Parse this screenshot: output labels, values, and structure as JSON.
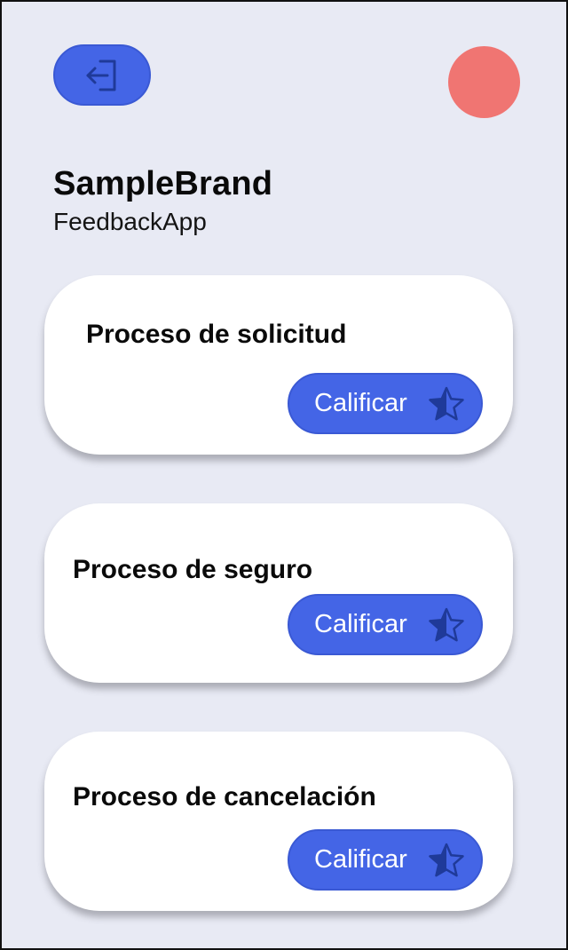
{
  "header": {
    "logout_icon": "logout-icon",
    "avatar_color": "#f07572"
  },
  "brand": {
    "name": "SampleBrand",
    "app": "FeedbackApp"
  },
  "cards": [
    {
      "title": "Proceso de solicitud",
      "button_label": "Calificar",
      "icon": "star-icon"
    },
    {
      "title": "Proceso de seguro",
      "button_label": "Calificar",
      "icon": "star-icon"
    },
    {
      "title": "Proceso de cancelación",
      "button_label": "Calificar",
      "icon": "star-icon"
    }
  ],
  "colors": {
    "background": "#e8eaf4",
    "accent": "#4465e6",
    "icon_dark": "#1f3a99"
  }
}
